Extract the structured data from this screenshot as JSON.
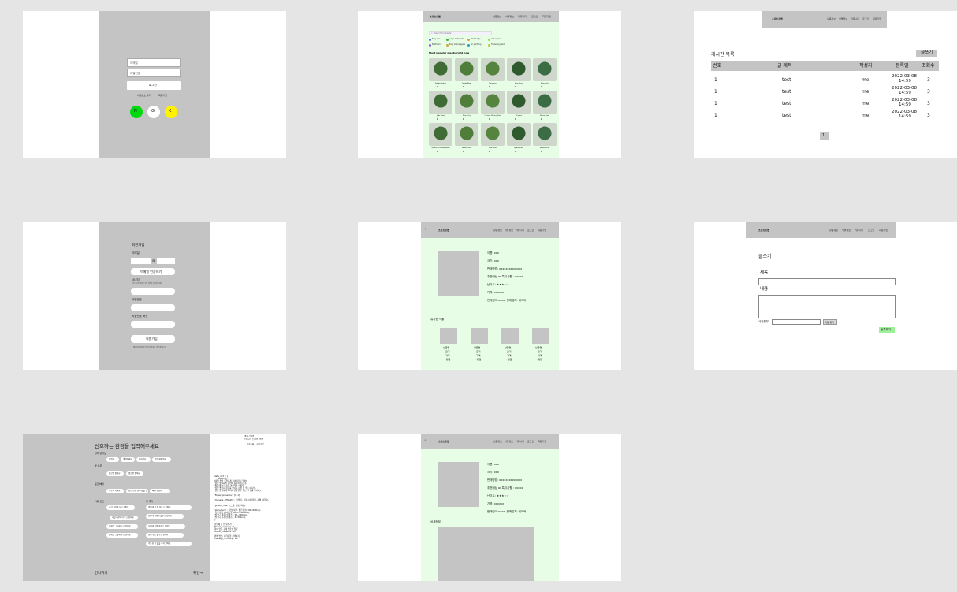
{
  "brand": "초로초로맵",
  "nav": [
    "상품정보",
    "식물정보",
    "커뮤니티",
    "로그인",
    "회원가입"
  ],
  "login": {
    "email_placeholder": "이메일",
    "password_placeholder": "비밀번호",
    "login_button": "로그인",
    "find_password": "비밀번호 찾기",
    "signup": "회원가입",
    "social": [
      {
        "letter": "N",
        "color": "#00d90f"
      },
      {
        "letter": "G",
        "color": "#ffffff"
      },
      {
        "letter": "K",
        "color": "#fff200"
      }
    ]
  },
  "catalog": {
    "search_placeholder": "Search for plants",
    "filters": [
      {
        "label": "Easy care",
        "color": "#6b6bd6"
      },
      {
        "label": "Large leaf plants",
        "color": "#3fae3f"
      },
      {
        "label": "Pet friendly",
        "color": "#e09a3a"
      },
      {
        "label": "Gift support",
        "color": "#9ad46b"
      },
      {
        "label": "Bathroom",
        "color": "#8a5bd6"
      },
      {
        "label": "Easy to propagate",
        "color": "#d6a63a"
      },
      {
        "label": "Air purifying",
        "color": "#2fa0c4"
      },
      {
        "label": "Flowering plants",
        "color": "#c4c43a"
      }
    ],
    "heading": "Most popular plants right now",
    "plants": [
      "Golden Pothos",
      "Snake Plant",
      "Monstera",
      "Aloe Vera",
      "Peace Lily",
      "Jade Plant",
      "Peace Lily",
      "Chinese Money Plant",
      "ZZ plant",
      "Nerve plant",
      "Heartleaf Philodendron",
      "Parlour Palm",
      "Aloe Vera",
      "Spider Plant",
      "Boston Fern"
    ]
  },
  "board": {
    "title": "게시판 목록",
    "write_button": "글쓰기",
    "columns": [
      "번호",
      "글 제목",
      "작성자",
      "등록일",
      "조회수"
    ],
    "rows": [
      {
        "no": "1",
        "title": "test",
        "author": "me",
        "date": "2022-03-08",
        "time": "14:59",
        "views": "3"
      },
      {
        "no": "1",
        "title": "test",
        "author": "me",
        "date": "2022-03-08",
        "time": "14:59",
        "views": "3"
      },
      {
        "no": "1",
        "title": "test",
        "author": "me",
        "date": "2022-03-08",
        "time": "14:59",
        "views": "3"
      },
      {
        "no": "1",
        "title": "test",
        "author": "me",
        "date": "2022-03-08",
        "time": "14:59",
        "views": "3"
      }
    ],
    "page": "1"
  },
  "signup": {
    "title": "회원가입",
    "email_label": "이메일",
    "at": "@",
    "verify_button": "이메일 인증하기",
    "nickname_label": "닉네임",
    "nickname_hint": "다른 유저와 겹치지 않는 별명을 입력해주세요",
    "password_label": "비밀번호",
    "password_confirm_label": "비밀번호 확인",
    "submit_button": "회원가입",
    "footer": "이미 아이디가 있으신가요? 로그인하기"
  },
  "detail": {
    "fields": [
      "이름: xxx",
      "크기: xxx",
      "판매방법: xxxxxxxxxxxxxx",
      "추천대상 or 특이사항 : xxxxx",
      "난이도: ★★★☆☆",
      "가격: xxxxxx",
      "판매링크:xxxx, 판매업체: 네이버"
    ],
    "similar_heading": "유사한 식물",
    "similar_items": [
      {
        "name": "상품명",
        "size": "크기",
        "price": "가격",
        "diff": "· 평점"
      },
      {
        "name": "상품명",
        "size": "크기",
        "price": "가격",
        "diff": "· 평점"
      },
      {
        "name": "상품명",
        "size": "크기",
        "price": "가격",
        "diff": "· 평점"
      },
      {
        "name": "상품명",
        "size": "크기",
        "price": "가격",
        "diff": "· 평점"
      }
    ],
    "info_heading": "상세정보"
  },
  "write": {
    "title": "글쓰기",
    "subject_label": "제목",
    "content_label": "내용",
    "attach_label": "사진첨부",
    "attach_button": "파일 찾기",
    "submit_button": "등록하기"
  },
  "survey": {
    "title": "선호하는 환경을 입력해주세요",
    "q1": "관리 난이도",
    "q1_opts": [
      "쉬워요",
      "괜찮아해요",
      "어려워요",
      "전문 재배종류"
    ],
    "q2": "꽃 유무",
    "q2_opts": [
      "있으면 좋아요",
      "없으면 좋아요"
    ],
    "q3": "공간/배치",
    "q3_opts": [
      "비교적 작아요",
      "높은 선반 위에 놓을 곳",
      "베란다 창가"
    ],
    "q4": "키워 조건",
    "q5": "물 주기",
    "q4_opts": [
      "거실 거실에 두고 싶어요",
      "거실 내부에서 두고 싶어요",
      "볕에는 그늘에 두고 싶어요",
      "볕에는 그늘에 두고 싶어요"
    ],
    "q5_opts": [
      "이틀에 한 번 물주고 싶어요",
      "한달에 한번만 물주고 싶어요",
      "두달에 한번 물주고 싶어요",
      "한번 정도 물주고 싶어요",
      "가능한 한 물을 주지 않아요"
    ],
    "skip": "건너뛰기",
    "next": "확인→",
    "top_right_1": "결과 산정법",
    "top_right_2": "추천시스템 알고리즘 검증중",
    "top_right_3": "식물등록    식물수정",
    "code": "data_dict = {\n    'watering':\n[제일 좋을 추천하게 되어지거나 있어]\n'물을 줄 1회씩 한번에 충분히 주는데,\n'엄청 좋아지 정도 관리하기 어렵다,\n'정말 좋아지 정도를 좋아지 장을 물 주는 아니면,\n'물을 좋아하게 되어서 달라질 수 있는 물 주를 좋아지],\n\n'flower_presence' : [0, 1],\n\n'manage_difficulty' : [쉬워요, 보통, 어려워요, 재배 어려움],\n\n'growth_rate' : [느림, 보통, 빠름],\n\n'placement' : [거실 내부, 밝은장소(100~800lux),\n'거실 창가 (실내조도 1000~2000lux),\n'발코니 내측 (실내조도 50~100lux),\n'발코니 창가 (실내조도 5~50lux)],\n}\n\n한달에 한 번 물주기\nflower_presence : 1\n물이 많은 곳에 많을수 있다\nflower_presence : 0.1\n\n판매 방법, 어려움을 선택하기\nmanage_difficulty : 1.2"
  }
}
